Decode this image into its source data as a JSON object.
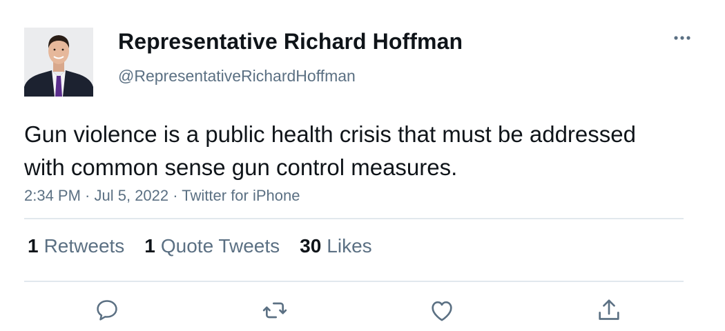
{
  "tweet": {
    "author": {
      "display_name": "Representative Richard Hoffman",
      "handle": "@RepresentativeRichardHoffman",
      "avatar_icon": "profile-photo"
    },
    "more_icon": "more-horizontal-icon",
    "text": "Gun violence is a public health crisis that must be addressed with common sense gun control measures.",
    "meta": {
      "time": "2:34 PM",
      "date": "Jul 5, 2022",
      "source": "Twitter for iPhone",
      "separator": " · "
    },
    "stats": {
      "retweets": {
        "count": "1",
        "label": "Retweets"
      },
      "quote_tweets": {
        "count": "1",
        "label": "Quote Tweets"
      },
      "likes": {
        "count": "30",
        "label": "Likes"
      }
    },
    "actions": [
      {
        "name": "reply",
        "icon": "reply-icon"
      },
      {
        "name": "retweet",
        "icon": "retweet-icon"
      },
      {
        "name": "like",
        "icon": "heart-icon"
      },
      {
        "name": "share",
        "icon": "share-icon"
      }
    ],
    "colors": {
      "text_primary": "#0f1419",
      "text_secondary": "#5b7083",
      "divider": "#e1e8ed",
      "icon": "#5b7083"
    }
  }
}
